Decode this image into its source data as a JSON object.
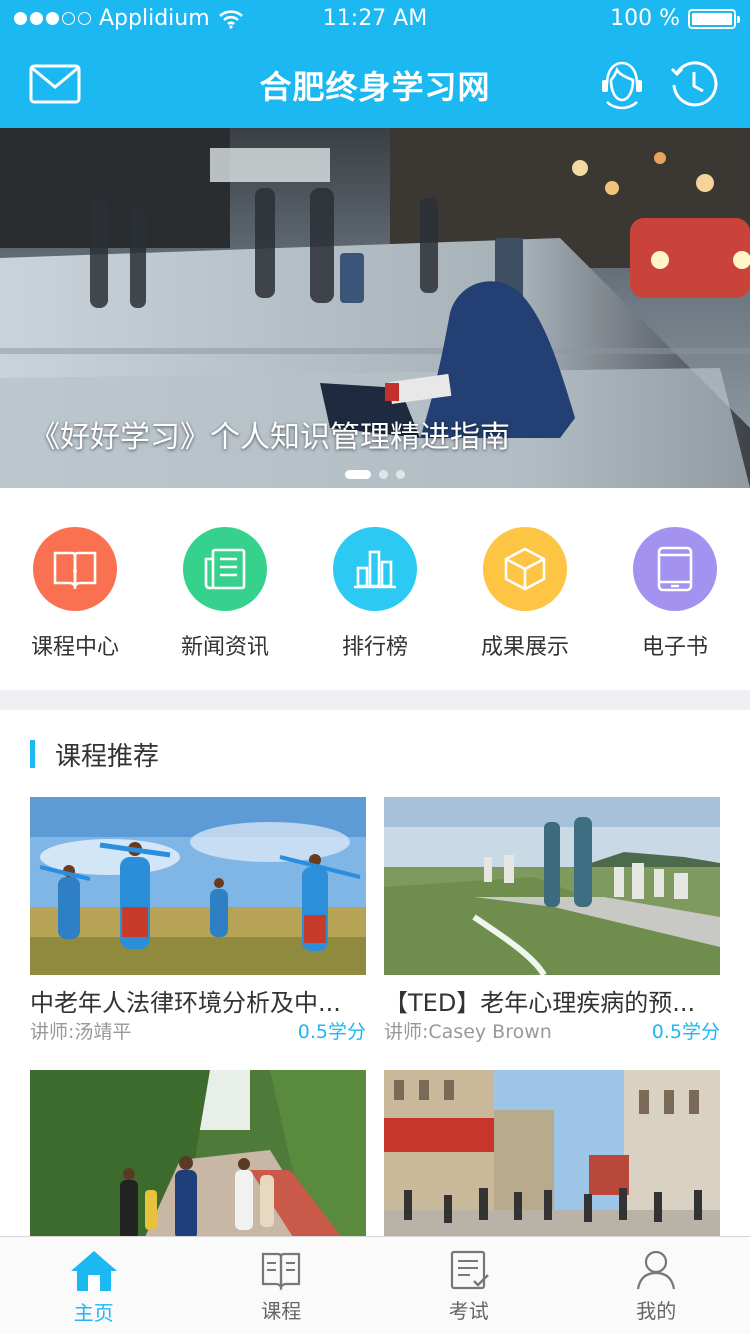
{
  "status_bar": {
    "carrier": "Applidium",
    "time": "11:27 AM",
    "battery": "100 %"
  },
  "header": {
    "title": "合肥终身学习网"
  },
  "banner": {
    "caption": "《好好学习》个人知识管理精进指南",
    "page_count": 3,
    "active_page": 1
  },
  "quick_entries": [
    {
      "label": "课程中心",
      "icon": "book-icon",
      "color": "#fa7151"
    },
    {
      "label": "新闻资讯",
      "icon": "news-icon",
      "color": "#36d28d"
    },
    {
      "label": "排行榜",
      "icon": "bar-chart-icon",
      "color": "#2cc9f3"
    },
    {
      "label": "成果展示",
      "icon": "cube-icon",
      "color": "#fec444"
    },
    {
      "label": "电子书",
      "icon": "tablet-icon",
      "color": "#a392f0"
    }
  ],
  "section": {
    "title": "课程推荐"
  },
  "courses": [
    {
      "title": "中老年人法律环境分析及中...",
      "teacher": "讲师:汤靖平",
      "credit": "0.5学分"
    },
    {
      "title": "【TED】老年心理疾病的预...",
      "teacher": "讲师:Casey Brown",
      "credit": "0.5学分"
    },
    {
      "title": "",
      "teacher": "",
      "credit": ""
    },
    {
      "title": "",
      "teacher": "",
      "credit": ""
    }
  ],
  "tabbar": [
    {
      "label": "主页",
      "icon": "home-icon",
      "active": true
    },
    {
      "label": "课程",
      "icon": "open-book-icon",
      "active": false
    },
    {
      "label": "考试",
      "icon": "exam-icon",
      "active": false
    },
    {
      "label": "我的",
      "icon": "user-icon",
      "active": false
    }
  ],
  "colors": {
    "accent": "#1bb8f2"
  }
}
